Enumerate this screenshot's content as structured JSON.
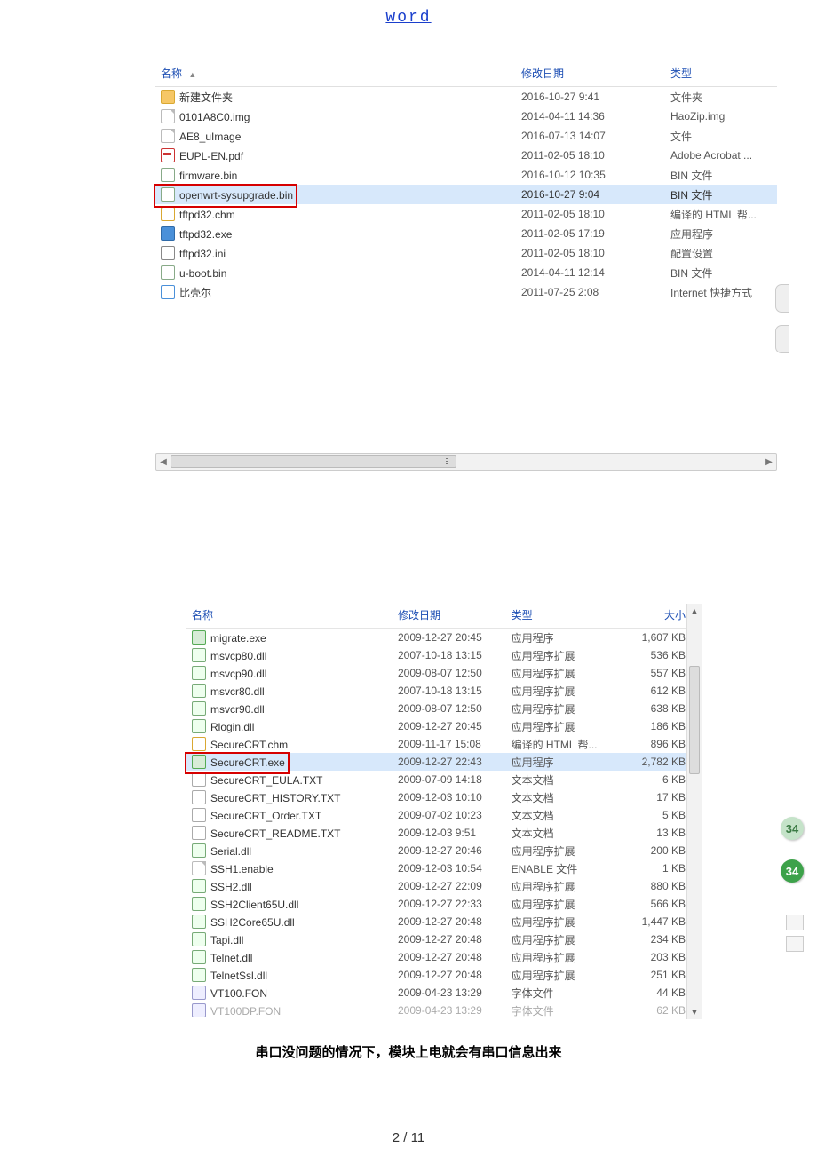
{
  "top_link": "word",
  "panel1": {
    "headers": {
      "name": "名称",
      "date": "修改日期",
      "type": "类型"
    },
    "rows": [
      {
        "icon": "folder",
        "name": "新建文件夹",
        "date": "2016-10-27 9:41",
        "type": "文件夹"
      },
      {
        "icon": "file",
        "name": "0101A8C0.img",
        "date": "2014-04-11 14:36",
        "type": "HaoZip.img"
      },
      {
        "icon": "file",
        "name": "AE8_uImage",
        "date": "2016-07-13 14:07",
        "type": "文件"
      },
      {
        "icon": "pdf",
        "name": "EUPL-EN.pdf",
        "date": "2011-02-05 18:10",
        "type": "Adobe Acrobat ..."
      },
      {
        "icon": "bin",
        "name": "firmware.bin",
        "date": "2016-10-12 10:35",
        "type": "BIN 文件"
      },
      {
        "icon": "bin",
        "name": "openwrt-sysupgrade.bin",
        "date": "2016-10-27 9:04",
        "type": "BIN 文件",
        "selected": true,
        "redbox": true
      },
      {
        "icon": "chm",
        "name": "tftpd32.chm",
        "date": "2011-02-05 18:10",
        "type": "编译的 HTML 帮..."
      },
      {
        "icon": "exe",
        "name": "tftpd32.exe",
        "date": "2011-02-05 17:19",
        "type": "应用程序"
      },
      {
        "icon": "ini",
        "name": "tftpd32.ini",
        "date": "2011-02-05 18:10",
        "type": "配置设置"
      },
      {
        "icon": "bin",
        "name": "u-boot.bin",
        "date": "2014-04-11 12:14",
        "type": "BIN 文件"
      },
      {
        "icon": "net",
        "name": "比壳尔",
        "date": "2011-07-25 2:08",
        "type": "Internet 快捷方式"
      }
    ]
  },
  "panel2": {
    "headers": {
      "name": "名称",
      "date": "修改日期",
      "type": "类型",
      "size": "大小"
    },
    "rows": [
      {
        "icon": "app",
        "name": "migrate.exe",
        "date": "2009-12-27 20:45",
        "type": "应用程序",
        "size": "1,607 KB"
      },
      {
        "icon": "dll",
        "name": "msvcp80.dll",
        "date": "2007-10-18 13:15",
        "type": "应用程序扩展",
        "size": "536 KB"
      },
      {
        "icon": "dll",
        "name": "msvcp90.dll",
        "date": "2009-08-07 12:50",
        "type": "应用程序扩展",
        "size": "557 KB"
      },
      {
        "icon": "dll",
        "name": "msvcr80.dll",
        "date": "2007-10-18 13:15",
        "type": "应用程序扩展",
        "size": "612 KB"
      },
      {
        "icon": "dll",
        "name": "msvcr90.dll",
        "date": "2009-08-07 12:50",
        "type": "应用程序扩展",
        "size": "638 KB"
      },
      {
        "icon": "dll",
        "name": "Rlogin.dll",
        "date": "2009-12-27 20:45",
        "type": "应用程序扩展",
        "size": "186 KB"
      },
      {
        "icon": "chm",
        "name": "SecureCRT.chm",
        "date": "2009-11-17 15:08",
        "type": "编译的 HTML 帮...",
        "size": "896 KB"
      },
      {
        "icon": "app",
        "name": "SecureCRT.exe",
        "date": "2009-12-27 22:43",
        "type": "应用程序",
        "size": "2,782 KB",
        "selected": true,
        "redbox": true
      },
      {
        "icon": "txt",
        "name": "SecureCRT_EULA.TXT",
        "date": "2009-07-09 14:18",
        "type": "文本文档",
        "size": "6 KB"
      },
      {
        "icon": "txt",
        "name": "SecureCRT_HISTORY.TXT",
        "date": "2009-12-03 10:10",
        "type": "文本文档",
        "size": "17 KB"
      },
      {
        "icon": "txt",
        "name": "SecureCRT_Order.TXT",
        "date": "2009-07-02 10:23",
        "type": "文本文档",
        "size": "5 KB"
      },
      {
        "icon": "txt",
        "name": "SecureCRT_README.TXT",
        "date": "2009-12-03 9:51",
        "type": "文本文档",
        "size": "13 KB"
      },
      {
        "icon": "dll",
        "name": "Serial.dll",
        "date": "2009-12-27 20:46",
        "type": "应用程序扩展",
        "size": "200 KB"
      },
      {
        "icon": "file",
        "name": "SSH1.enable",
        "date": "2009-12-03 10:54",
        "type": "ENABLE 文件",
        "size": "1 KB"
      },
      {
        "icon": "dll",
        "name": "SSH2.dll",
        "date": "2009-12-27 22:09",
        "type": "应用程序扩展",
        "size": "880 KB"
      },
      {
        "icon": "dll",
        "name": "SSH2Client65U.dll",
        "date": "2009-12-27 22:33",
        "type": "应用程序扩展",
        "size": "566 KB"
      },
      {
        "icon": "dll",
        "name": "SSH2Core65U.dll",
        "date": "2009-12-27 20:48",
        "type": "应用程序扩展",
        "size": "1,447 KB"
      },
      {
        "icon": "dll",
        "name": "Tapi.dll",
        "date": "2009-12-27 20:48",
        "type": "应用程序扩展",
        "size": "234 KB"
      },
      {
        "icon": "dll",
        "name": "Telnet.dll",
        "date": "2009-12-27 20:48",
        "type": "应用程序扩展",
        "size": "203 KB"
      },
      {
        "icon": "dll",
        "name": "TelnetSsl.dll",
        "date": "2009-12-27 20:48",
        "type": "应用程序扩展",
        "size": "251 KB"
      },
      {
        "icon": "font",
        "name": "VT100.FON",
        "date": "2009-04-23 13:29",
        "type": "字体文件",
        "size": "44 KB"
      },
      {
        "icon": "font",
        "name": "VT100DP.FON",
        "date": "2009-04-23 13:29",
        "type": "字体文件",
        "size": "62 KB",
        "faded": true
      }
    ]
  },
  "badges": {
    "b1": "34",
    "b2": "34"
  },
  "caption": "串口没问题的情况下，模块上电就会有串口信息出来",
  "page_number": "2 / 11"
}
